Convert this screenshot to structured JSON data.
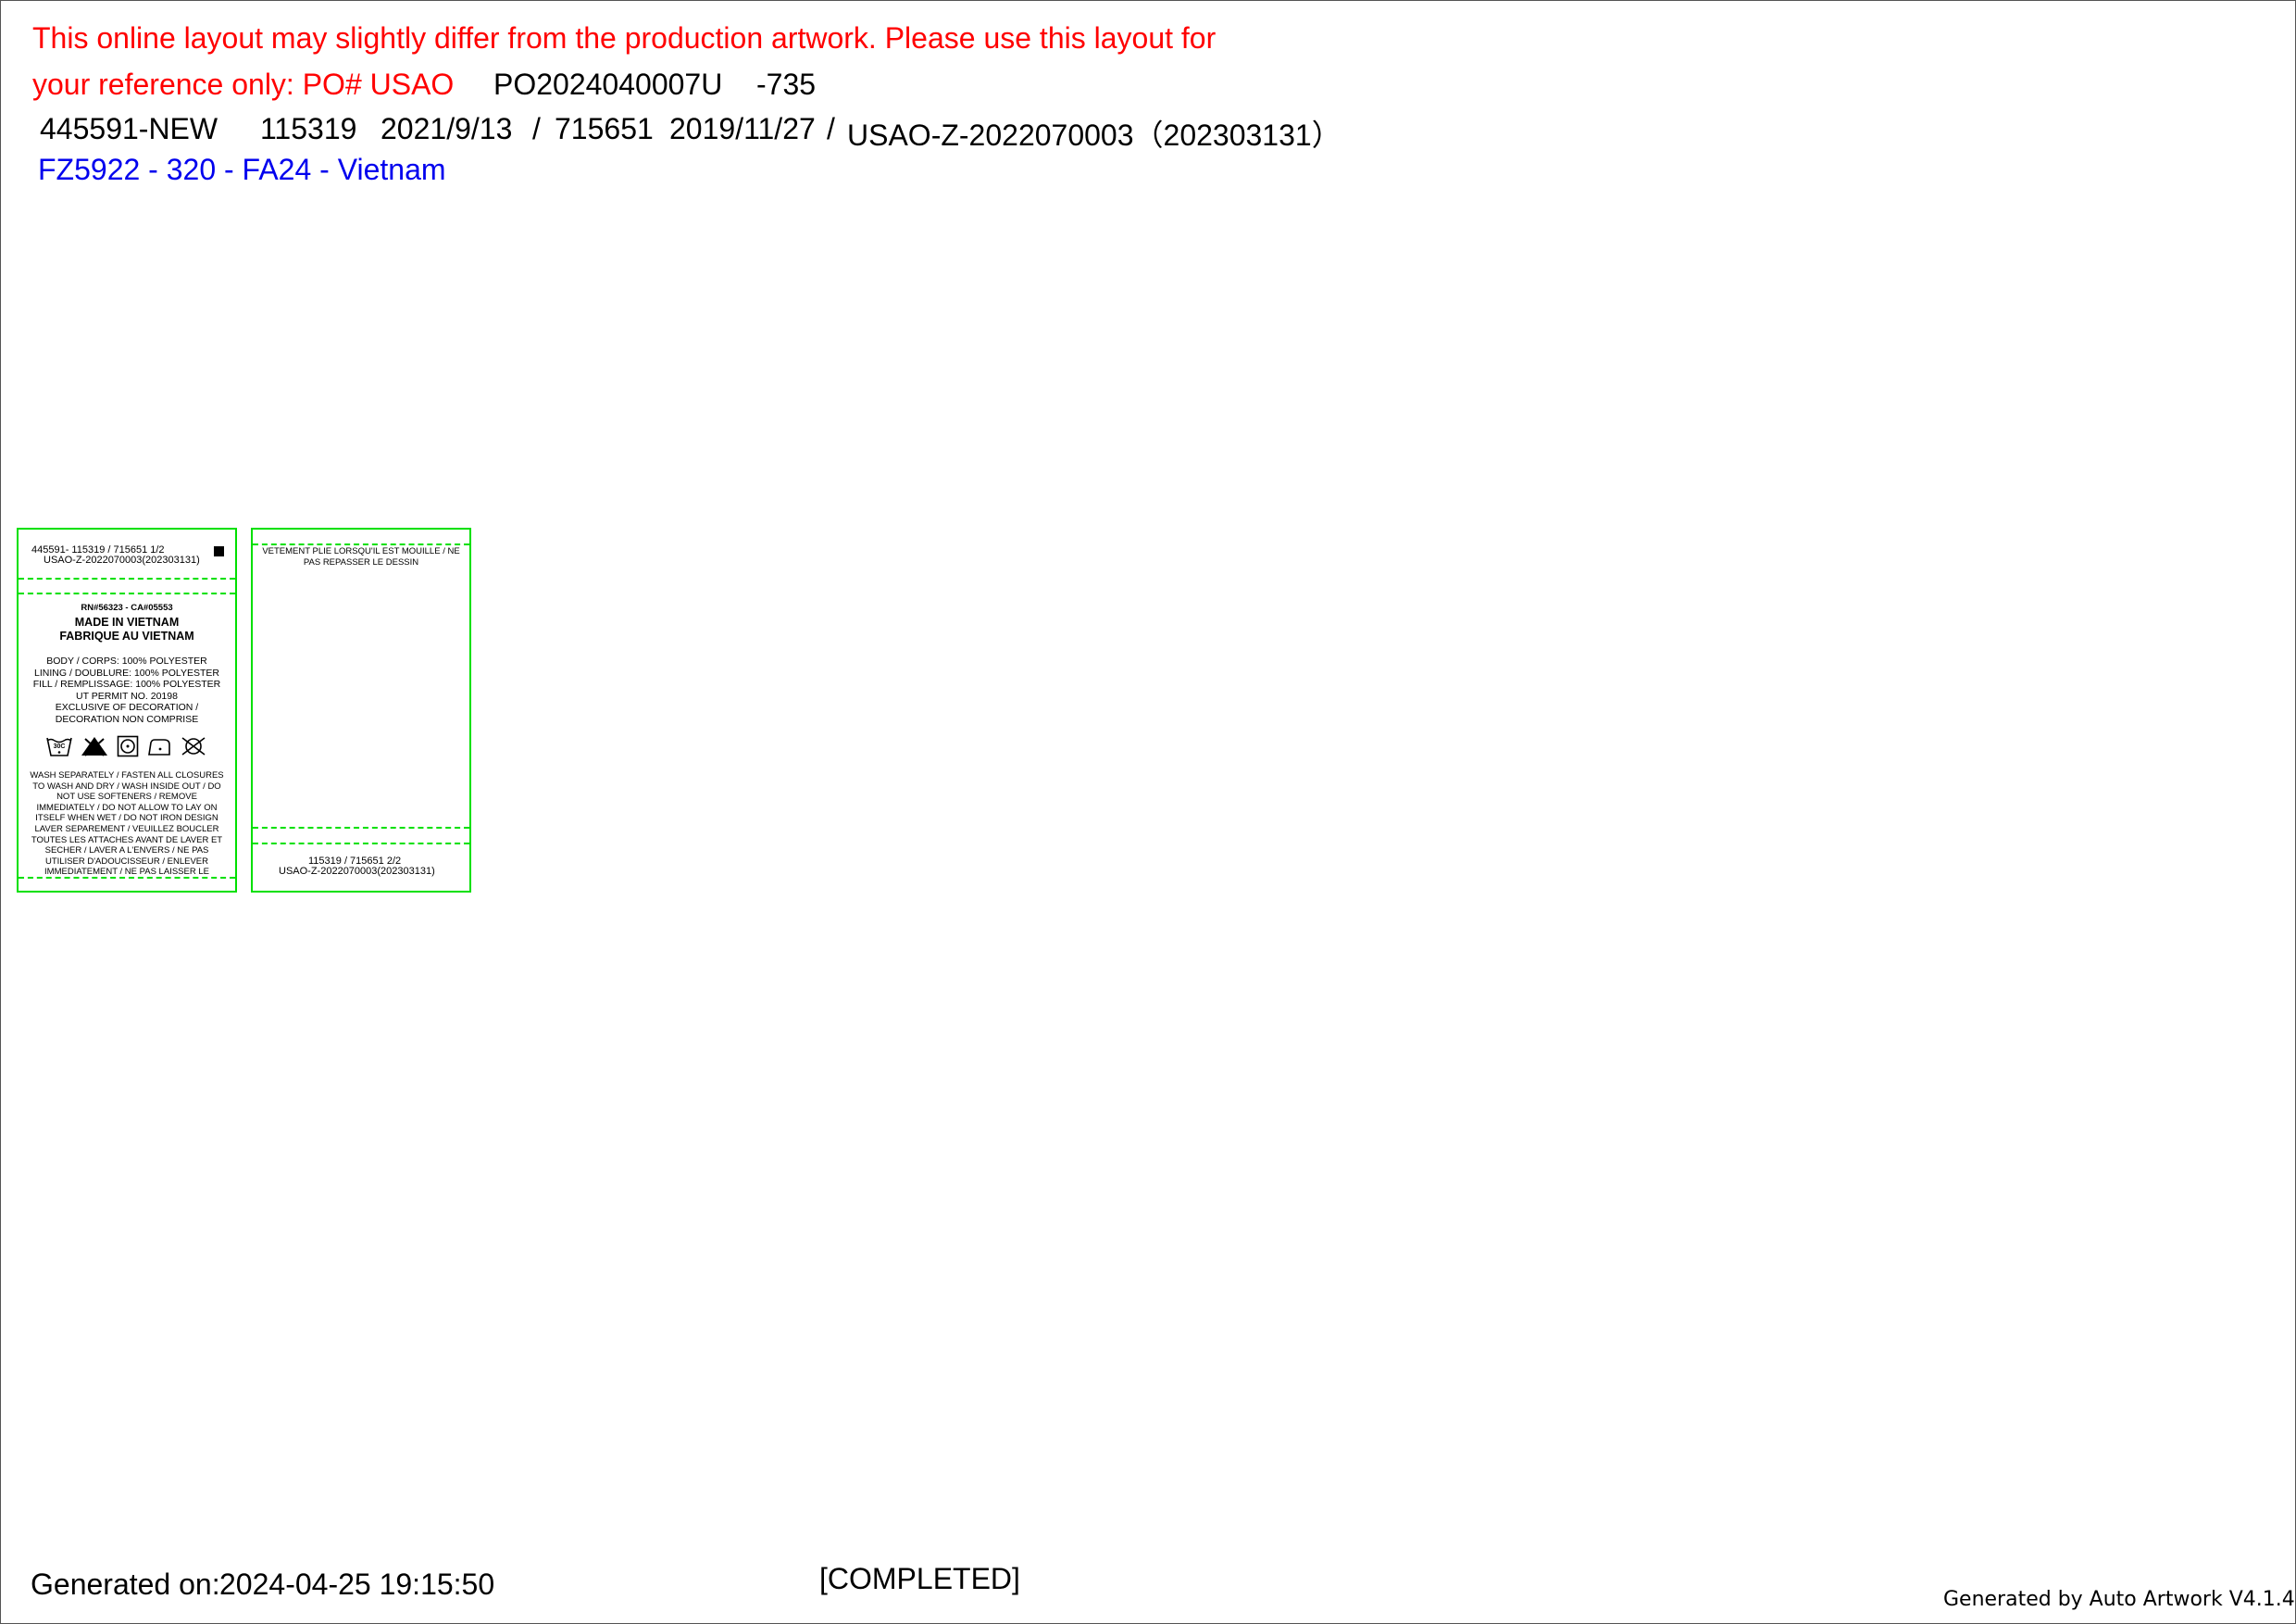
{
  "header": {
    "disclaimer_line1": "This online layout may slightly differ from the production artwork. Please use this layout for",
    "disclaimer_line2": "your reference only: PO# USAO",
    "po_number": "PO2024040007U",
    "po_suffix": "-735",
    "style_code": "445591-NEW",
    "ref1": "115319",
    "date1": "2021/9/13",
    "sep1": "/",
    "ref2": "715651",
    "date2": "2019/11/27",
    "sep2": "/",
    "usao_ref": "USAO-Z-2022070003（202303131）",
    "product_line": "FZ5922 - 320 - FA24 - Vietnam"
  },
  "label_front": {
    "top_line1": "445591-  115319 / 715651     1/2",
    "top_line2": "USAO-Z-2022070003(202303131)",
    "rn_ca": "RN#56323 - CA#05553",
    "made_in": "MADE IN VIETNAM",
    "fabrique": "FABRIQUE AU VIETNAM",
    "content_lines": [
      "BODY / CORPS: 100% POLYESTER",
      "LINING / DOUBLURE: 100% POLYESTER",
      "FILL / REMPLISSAGE: 100% POLYESTER",
      "UT PERMIT NO. 20198",
      "EXCLUSIVE OF DECORATION /",
      "DECORATION NON COMPRISE"
    ],
    "wash_temp": "30C",
    "care_icons": [
      "wash-30-icon",
      "no-bleach-icon",
      "tumble-dry-low-icon",
      "iron-low-icon",
      "do-not-dryclean-icon"
    ],
    "care_text_lines": [
      "WASH SEPARATELY / FASTEN ALL CLOSURES",
      "TO WASH AND DRY / WASH INSIDE OUT / DO",
      "NOT USE SOFTENERS / REMOVE",
      "IMMEDIATELY / DO NOT ALLOW TO LAY ON",
      "ITSELF WHEN WET / DO NOT IRON DESIGN",
      "LAVER SEPAREMENT / VEUILLEZ BOUCLER",
      "TOUTES LES ATTACHES AVANT DE LAVER ET",
      "SECHER / LAVER A L'ENVERS / NE PAS",
      "UTILISER D'ADOUCISSEUR / ENLEVER",
      "IMMEDIATEMENT / NE PAS LAISSER LE"
    ]
  },
  "label_back": {
    "top_line1": "VETEMENT PLIE LORSQU'IL EST MOUILLE / NE",
    "top_line2": "PAS REPASSER LE DESSIN",
    "bottom_line1": "115319  / 715651     2/2",
    "bottom_line2": "USAO-Z-2022070003(202303131)"
  },
  "footer": {
    "generated_on_label": "Generated on:",
    "generated_on_value": "2024-04-25 19:15:50",
    "status": "[COMPLETED]",
    "generator": "Generated by Auto Artwork V4.1.4"
  },
  "colors": {
    "disclaimer": "#ff0000",
    "product_line": "#0000ee",
    "label_border": "#00e000"
  }
}
